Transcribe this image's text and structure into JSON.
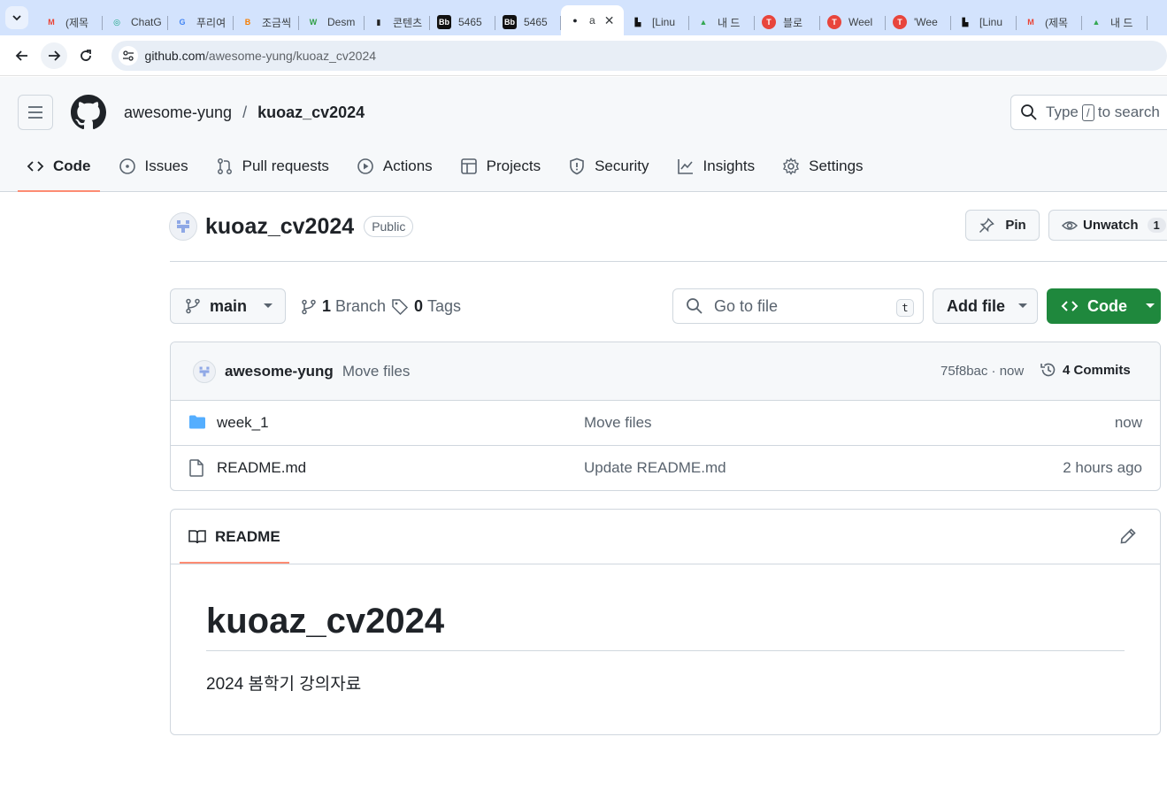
{
  "browser": {
    "tabs": [
      {
        "title": "(제목",
        "icon": "gmail-icon",
        "color": "#ea4335",
        "glyph": "M"
      },
      {
        "title": "ChatG",
        "icon": "chatgpt-icon",
        "color": "#10a37f",
        "glyph": "◎"
      },
      {
        "title": "푸리여",
        "icon": "google-icon",
        "color": "#4285f4",
        "glyph": "G"
      },
      {
        "title": "조금씩",
        "icon": "blogger-icon",
        "color": "#f57d00",
        "glyph": "B"
      },
      {
        "title": "Desm",
        "icon": "desmos-icon",
        "color": "#2f9e44",
        "glyph": "W"
      },
      {
        "title": "콘텐츠",
        "icon": "chart-icon",
        "color": "#222222",
        "glyph": "▮"
      },
      {
        "title": "5465",
        "icon": "blackboard-icon",
        "color": "#111111",
        "glyph": "Bb"
      },
      {
        "title": "5465",
        "icon": "blackboard-icon",
        "color": "#111111",
        "glyph": "Bb"
      },
      {
        "title": "a",
        "icon": "github-icon",
        "color": "#1f2328",
        "glyph": "●",
        "active": true
      },
      {
        "title": "[Linu",
        "icon": "factory-icon",
        "color": "#111111",
        "glyph": "▙"
      },
      {
        "title": "내 드",
        "icon": "drive-icon",
        "color": "#34a853",
        "glyph": "▲"
      },
      {
        "title": "블로",
        "icon": "red-circle-icon",
        "color": "#e8453c",
        "glyph": "T"
      },
      {
        "title": "Weel",
        "icon": "red-circle-icon",
        "color": "#e8453c",
        "glyph": "T"
      },
      {
        "title": "'Wee",
        "icon": "red-circle-icon",
        "color": "#e8453c",
        "glyph": "T"
      },
      {
        "title": "[Linu",
        "icon": "factory-icon",
        "color": "#111111",
        "glyph": "▙"
      },
      {
        "title": "(제목",
        "icon": "gmail-icon",
        "color": "#ea4335",
        "glyph": "M"
      },
      {
        "title": "내 드",
        "icon": "drive-icon",
        "color": "#34a853",
        "glyph": "▲"
      }
    ],
    "url_host": "github.com",
    "url_path": "/awesome-yung/kuoaz_cv2024"
  },
  "header": {
    "owner": "awesome-yung",
    "separator": "/",
    "repo": "kuoaz_cv2024",
    "search_prefix": "Type",
    "search_key": "/",
    "search_suffix": "to search"
  },
  "nav": {
    "code": "Code",
    "issues": "Issues",
    "pulls": "Pull requests",
    "actions": "Actions",
    "projects": "Projects",
    "security": "Security",
    "insights": "Insights",
    "settings": "Settings"
  },
  "repo": {
    "name": "kuoaz_cv2024",
    "visibility": "Public",
    "pin_label": "Pin",
    "watch_label": "Unwatch",
    "watch_count": "1"
  },
  "filenav": {
    "branch": "main",
    "branch_count": "1",
    "branch_label": "Branch",
    "tag_count": "0",
    "tag_label": "Tags",
    "gofile_placeholder": "Go to file",
    "gofile_key": "t",
    "add_file": "Add file",
    "code_button": "Code"
  },
  "commit": {
    "author": "awesome-yung",
    "message": "Move files",
    "sha_time": "75f8bac · now",
    "commits_count": "4",
    "commits_label": "Commits"
  },
  "files": [
    {
      "type": "folder",
      "name": "week_1",
      "message": "Move files",
      "age": "now"
    },
    {
      "type": "file",
      "name": "README.md",
      "message": "Update README.md",
      "age": "2 hours ago"
    }
  ],
  "readme": {
    "tab": "README",
    "heading": "kuoaz_cv2024",
    "body": "2024 봄학기 강의자료"
  },
  "colors": {
    "accent_underline": "#fd8c73",
    "code_button": "#1f883d",
    "folder": "#54aeff"
  }
}
